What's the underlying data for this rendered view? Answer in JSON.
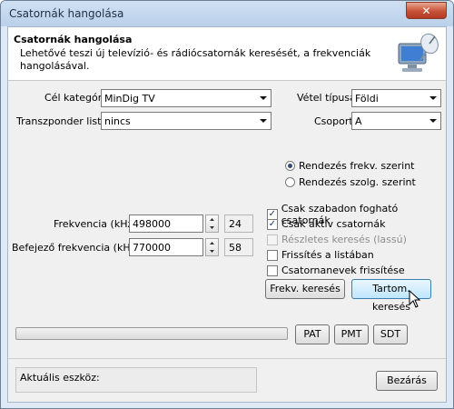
{
  "window": {
    "title": "Csatornák hangolása",
    "close_label": "✕"
  },
  "header": {
    "title": "Csatornák hangolása",
    "description": "Lehetővé teszi új televízió- és rádiócsatornák keresését, a frekvenciák hangolásával.",
    "icon": "computer-dish-icon"
  },
  "form": {
    "target_category_label": "Cél kategória",
    "target_category_value": "MinDig TV",
    "transponder_label": "Transzponder lista",
    "transponder_value": "nincs",
    "reception_label": "Vétel típusa",
    "reception_value": "Földi",
    "group_label": "Csoport",
    "group_value": "A"
  },
  "sort": {
    "by_freq_label": "Rendezés frekv. szerint",
    "by_freq_checked": true,
    "by_serv_label": "Rendezés szolg. szerint",
    "by_serv_checked": false
  },
  "frequency": {
    "label": "Frekvencia (kHz)",
    "value": "498000",
    "channel": "24"
  },
  "end_frequency": {
    "label": "Befejező frekvencia (kHz)",
    "value": "770000",
    "channel": "58"
  },
  "options": [
    {
      "label": "Csak szabadon fogható csatornák",
      "checked": true,
      "disabled": false
    },
    {
      "label": "Csak aktív csatornák",
      "checked": true,
      "disabled": false
    },
    {
      "label": "Részletes keresés (lassú)",
      "checked": false,
      "disabled": true
    },
    {
      "label": "Frissítés a listában",
      "checked": false,
      "disabled": false
    },
    {
      "label": "Csatornanevek frissítése",
      "checked": false,
      "disabled": false
    }
  ],
  "buttons": {
    "freq_search": "Frekv. keresés",
    "range_search": "Tartom. keresés",
    "pat": "PAT",
    "pmt": "PMT",
    "sdt": "SDT",
    "close": "Bezárás"
  },
  "progress": {
    "fraction": 0
  },
  "status": {
    "current_device_label": "Aktuális eszköz:"
  },
  "colors": {
    "accent": "#3c7fb1",
    "close_button": "#c75339"
  }
}
